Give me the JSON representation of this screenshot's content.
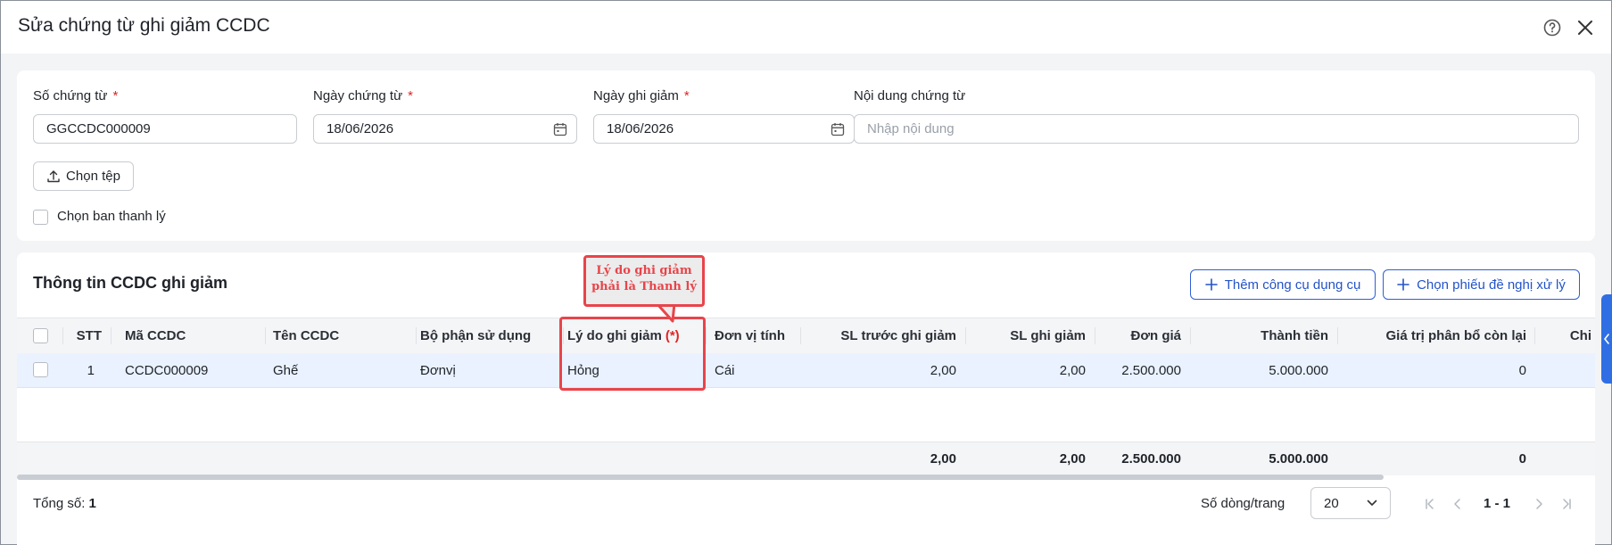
{
  "dialog": {
    "title": "Sửa chứng từ ghi giảm CCDC",
    "help_icon": "question-circle-icon",
    "close_icon": "close-x-icon"
  },
  "form": {
    "so_chung_tu": {
      "label": "Số chứng từ",
      "required_mark": "*",
      "value": "GGCCDC000009"
    },
    "ngay_chung_tu": {
      "label": "Ngày chứng từ",
      "required_mark": "*",
      "value": "18/06/2026",
      "icon": "calendar-icon"
    },
    "ngay_ghi_giam": {
      "label": "Ngày ghi giảm",
      "required_mark": "*",
      "value": "18/06/2026",
      "icon": "calendar-icon"
    },
    "noi_dung": {
      "label": "Nội dung chứng từ",
      "value": "",
      "placeholder": "Nhập nội dung"
    },
    "file_button": {
      "label": "Chọn tệp",
      "icon": "upload-icon"
    },
    "ban_thanh_ly": {
      "label": "Chọn ban thanh lý",
      "checked": false
    }
  },
  "grid": {
    "title": "Thông tin CCDC ghi giảm",
    "add_button": "Thêm công cụ dụng cụ",
    "select_button": "Chọn phiếu đề nghị xử lý",
    "columns": {
      "stt": "STT",
      "ma": "Mã CCDC",
      "ten": "Tên CCDC",
      "bo_phan": "Bộ phận sử dụng",
      "ly_do": "Lý do ghi giảm",
      "ly_do_req": "(*)",
      "dvt": "Đơn vị tính",
      "sl_truoc": "SL trước ghi giảm",
      "sl_ghi_giam": "SL ghi giảm",
      "don_gia": "Đơn giá",
      "thanh_tien": "Thành tiền",
      "gia_tri_con_lai": "Giá trị phân bổ còn lại",
      "chi": "Chi"
    },
    "rows": [
      {
        "stt": "1",
        "ma": "CCDC000009",
        "ten": "Ghế",
        "bo_phan": "Đơnvị",
        "ly_do": "Hỏng",
        "dvt": "Cái",
        "sl_truoc": "2,00",
        "sl_ghi_giam": "2,00",
        "don_gia": "2.500.000",
        "thanh_tien": "5.000.000",
        "gia_tri_con_lai": "0"
      }
    ],
    "totals": {
      "sl_truoc": "2,00",
      "sl_ghi_giam": "2,00",
      "don_gia": "2.500.000",
      "thanh_tien": "5.000.000",
      "gia_tri_con_lai": "0"
    }
  },
  "footer": {
    "total_label": "Tổng số:",
    "total_value": "1",
    "rows_per_page_label": "Số dòng/trang",
    "rows_per_page_value": "20",
    "page_range": "1 - 1"
  },
  "annotation": {
    "line1": "Lý do ghi giảm",
    "line2": "phải là Thanh lý",
    "color": "#e8444a"
  }
}
